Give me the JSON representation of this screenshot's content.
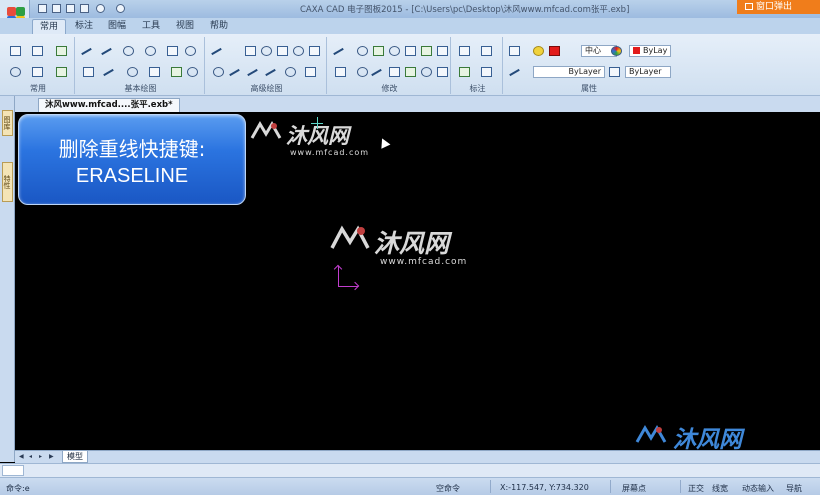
{
  "window": {
    "title": "CAXA CAD 电子图板2015 - [C:\\Users\\pc\\Desktop\\沐风www.mfcad.com张平.exb]",
    "popup_button": "窗口弹出"
  },
  "ribbon": {
    "tabs": [
      "常用",
      "标注",
      "图幅",
      "工具",
      "视图",
      "帮助"
    ],
    "active_tab": "常用",
    "style_label": "风格",
    "groups": [
      "常用",
      "基本绘图",
      "高级绘图",
      "修改",
      "标注",
      "属性"
    ],
    "combos": {
      "center": "中心",
      "color_top": "ByLay",
      "linetype": "ByLayer",
      "color_bottom": "ByLayer"
    }
  },
  "side_tabs": [
    "图库",
    "特性"
  ],
  "document": {
    "tab": "沐风www.mfcad....张平.exb*"
  },
  "overlay": {
    "line1": "删除重线快捷键:",
    "line2": "ERASELINE"
  },
  "watermarks": [
    {
      "cn": "沐风网",
      "url": "www.mfcad.com"
    },
    {
      "cn": "沐风网",
      "url": "www.mfcad.com"
    },
    {
      "cn": "沐风网",
      "url": "www.mfcad.com"
    }
  ],
  "layout": {
    "model_tab": "模型"
  },
  "command": {
    "prompt": "命令:e"
  },
  "status": {
    "idle": "空命令",
    "coords": "X:-117.547, Y:734.320",
    "snap": "屏幕点",
    "ortho": "正交",
    "linewidth": "线宽",
    "dynamic_input": "动态输入",
    "nav": "导航"
  },
  "colors": {
    "accent": "#f07d1b",
    "panel_blue": "#2b74e0",
    "canvas": "#000000",
    "ucs": "#c23ecf"
  }
}
